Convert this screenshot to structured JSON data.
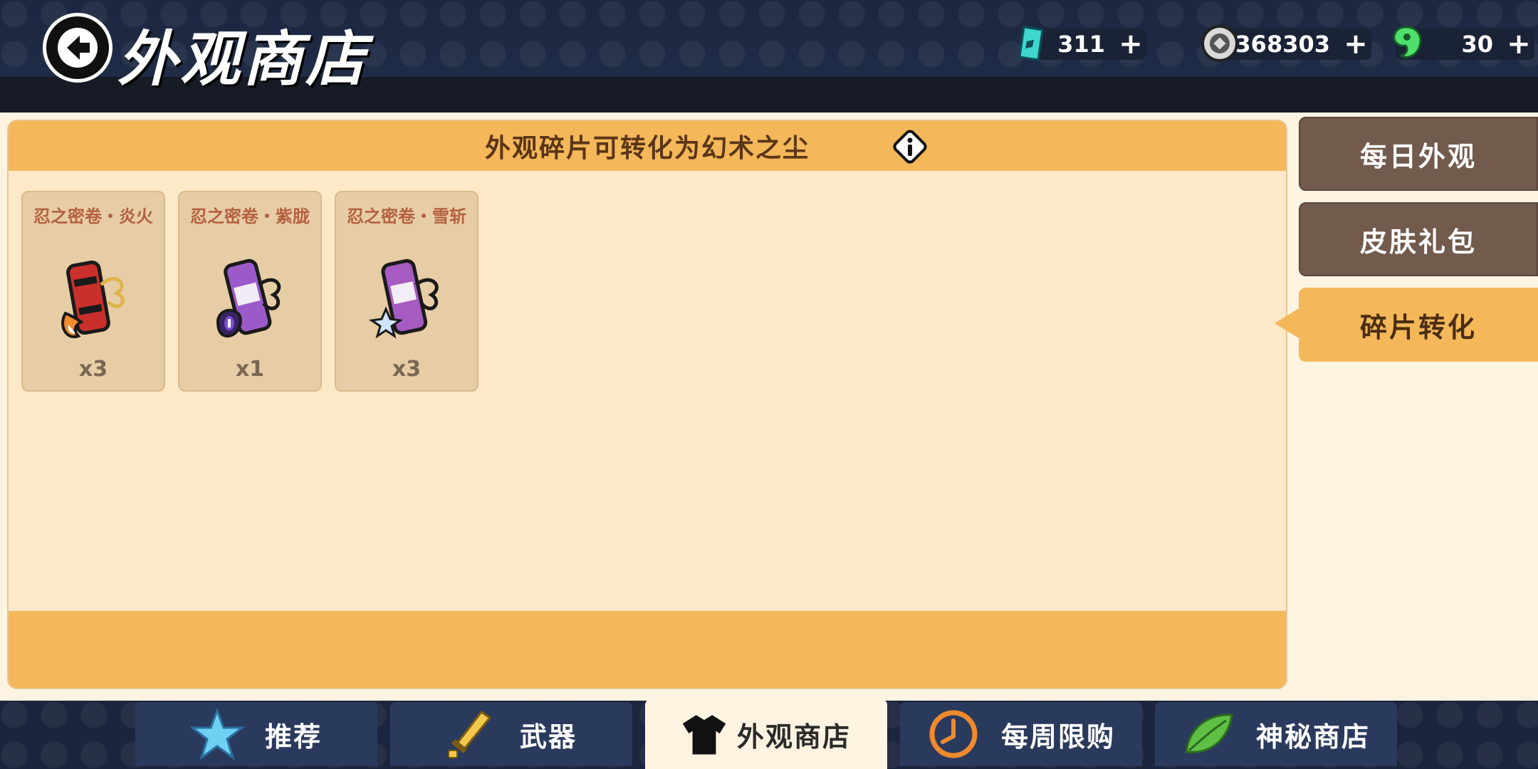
{
  "header": {
    "title": "外观商店",
    "currencies": [
      {
        "icon": "ticket-icon",
        "amount": "311"
      },
      {
        "icon": "coin-icon",
        "amount": "368303"
      },
      {
        "icon": "jade-icon",
        "amount": "30"
      }
    ],
    "plus_label": "+"
  },
  "panel": {
    "header_text": "外观碎片可转化为幻术之尘",
    "info_label": "i",
    "items": [
      {
        "name": "忍之密卷・炎火",
        "qty": "x3"
      },
      {
        "name": "忍之密卷・紫胧",
        "qty": "x1"
      },
      {
        "name": "忍之密卷・雪斩",
        "qty": "x3"
      }
    ]
  },
  "side_tabs": [
    {
      "label": "每日外观",
      "active": false
    },
    {
      "label": "皮肤礼包",
      "active": false
    },
    {
      "label": "碎片转化",
      "active": true
    }
  ],
  "nav": [
    {
      "label": "推荐",
      "icon": "star-icon"
    },
    {
      "label": "武器",
      "icon": "sword-icon"
    },
    {
      "label": "外观商店",
      "icon": "shirt-icon",
      "active": true
    },
    {
      "label": "每周限购",
      "icon": "clock-icon"
    },
    {
      "label": "神秘商店",
      "icon": "leaf-icon"
    }
  ],
  "colors": {
    "accent": "#f4b75a",
    "panel_bg": "#fde9c8",
    "nav_bg": "#2a3a5d",
    "side_tab_inactive": "#725a4c"
  }
}
